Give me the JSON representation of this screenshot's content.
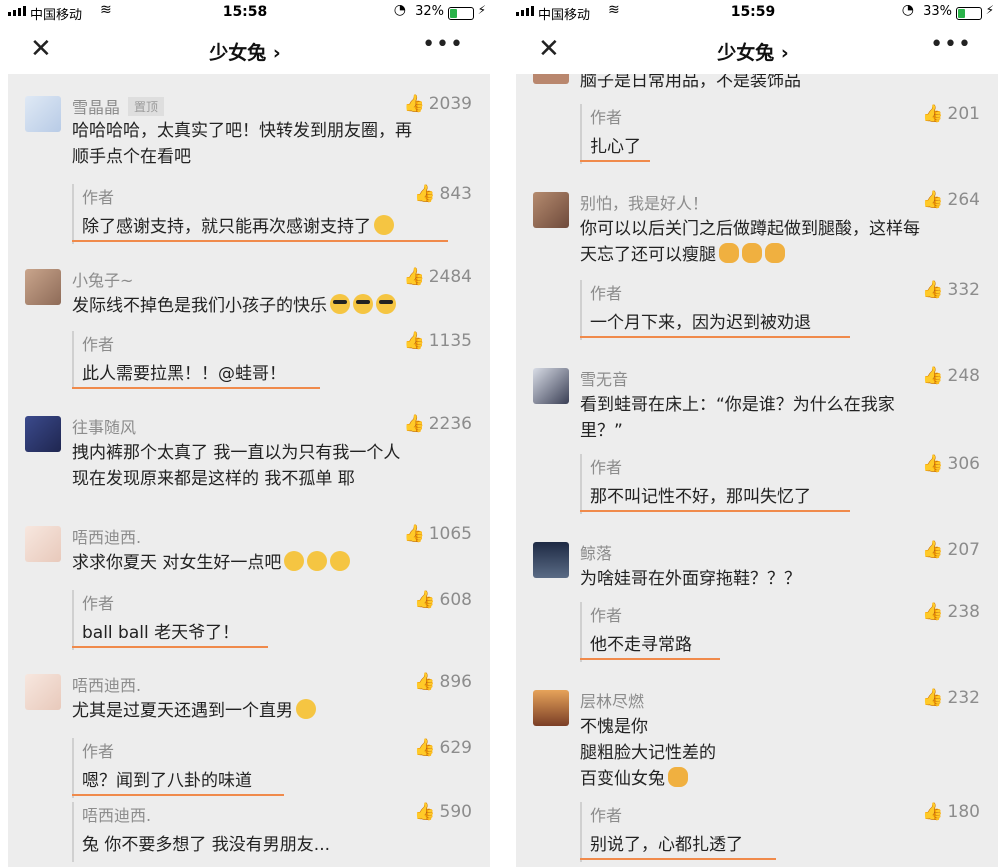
{
  "left": {
    "status": {
      "carrier": "中国移动",
      "time": "15:58",
      "battery": "32%"
    },
    "nav": {
      "title": "少女兔 ›",
      "close": "✕",
      "more": "•••"
    },
    "comments": [
      {
        "name": "雪晶晶",
        "badge": "置顶",
        "likes": "2039",
        "text_lines": [
          "哈哈哈哈，太真实了吧！快转发到朋友圈，再",
          "顺手点个在看吧"
        ],
        "reply": {
          "author": "作者",
          "likes": "843",
          "text": "除了感谢支持，就只能再次感谢支持了"
        }
      },
      {
        "name": "小兔子~",
        "likes": "2484",
        "text_lines": [
          "发际线不掉色是我们小孩子的快乐"
        ],
        "reply": {
          "author": "作者",
          "likes": "1135",
          "text": "此人需要拉黑！！@蛙哥！"
        }
      },
      {
        "name": "往事随风",
        "likes": "2236",
        "text_lines": [
          "拽内裤那个太真了 我一直以为只有我一个人",
          "现在发现原来都是这样的 我不孤单 耶"
        ]
      },
      {
        "name": "唔西迪西.",
        "likes": "1065",
        "text_lines": [
          "求求你夏天 对女生好一点吧"
        ],
        "reply": {
          "author": "作者",
          "likes": "608",
          "text": "ball ball 老天爷了！"
        }
      },
      {
        "name": "唔西迪西.",
        "likes": "896",
        "text_lines": [
          "尤其是过夏天还遇到一个直男"
        ],
        "reply": {
          "author": "作者",
          "likes": "629",
          "text": "嗯？闻到了八卦的味道"
        },
        "reply2": {
          "author": "唔西迪西.",
          "likes": "590",
          "text": "兔 你不要多想了 我没有男朋友..."
        }
      }
    ]
  },
  "right": {
    "status": {
      "carrier": "中国移动",
      "time": "15:59",
      "battery": "33%"
    },
    "nav": {
      "title": "少女兔 ›",
      "close": "✕",
      "more": "•••"
    },
    "top_cut_text": "脑子是日常用品，不是装饰品",
    "top_reply": {
      "author": "作者",
      "likes": "201",
      "text": "扎心了"
    },
    "comments": [
      {
        "name": "别怕，我是好人！",
        "likes": "264",
        "text_lines": [
          "你可以以后关门之后做蹲起做到腿酸，这样每",
          "天忘了还可以瘦腿"
        ],
        "reply": {
          "author": "作者",
          "likes": "332",
          "text": "一个月下来，因为迟到被劝退"
        }
      },
      {
        "name": "雪无音",
        "likes": "248",
        "text_lines": [
          "看到蛙哥在床上：“你是谁？为什么在我家",
          "里？”"
        ],
        "reply": {
          "author": "作者",
          "likes": "306",
          "text": "那不叫记性不好，那叫失忆了"
        }
      },
      {
        "name": "鲸落",
        "likes": "207",
        "text_lines": [
          "为啥娃哥在外面穿拖鞋？？？"
        ],
        "reply": {
          "author": "作者",
          "likes": "238",
          "text": "他不走寻常路"
        }
      },
      {
        "name": "层林尽燃",
        "likes": "232",
        "text_lines": [
          "不愧是你",
          "腿粗脸大记性差的",
          "百变仙女兔"
        ],
        "reply": {
          "author": "作者",
          "likes": "180",
          "text": "别说了，心都扎透了"
        }
      }
    ]
  },
  "colors": {
    "underline": "#f08a4b",
    "background": "#ededed",
    "meta_text": "#8c8c8c"
  }
}
